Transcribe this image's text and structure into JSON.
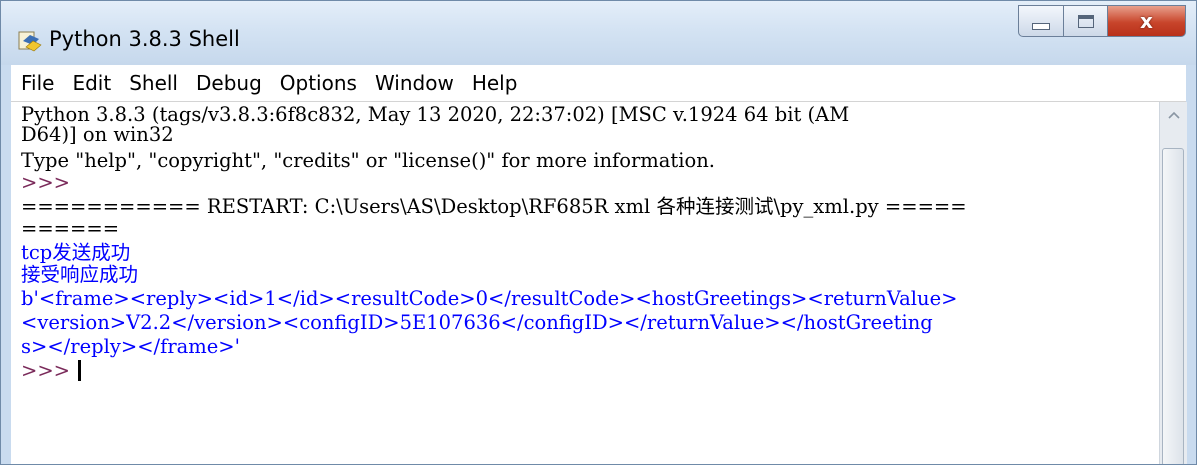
{
  "window": {
    "title": "Python 3.8.3 Shell",
    "close_glyph": "x"
  },
  "menu": [
    "File",
    "Edit",
    "Shell",
    "Debug",
    "Options",
    "Window",
    "Help"
  ],
  "shell": {
    "lines": [
      {
        "text": "Python 3.8.3 (tags/v3.8.3:6f8c832, May 13 2020, 22:37:02) [MSC v.1924 64 bit (AM",
        "color": "black"
      },
      {
        "text": "D64)] on win32",
        "color": "black"
      },
      {
        "text": "Type \"help\", \"copyright\", \"credits\" or \"license()\" for more information.",
        "color": "black"
      },
      {
        "text": ">>>",
        "color": "prompt"
      },
      {
        "text": "=========== RESTART: C:\\Users\\AS\\Desktop\\RF685R xml 各种连接测试\\py_xml.py =====",
        "color": "black"
      },
      {
        "text": "======",
        "color": "black"
      },
      {
        "text": "tcp发送成功",
        "color": "blue"
      },
      {
        "text": "接受响应成功",
        "color": "blue"
      },
      {
        "text": "b'<frame><reply><id>1</id><resultCode>0</resultCode><hostGreetings><returnValue>",
        "color": "blue"
      },
      {
        "text": "<version>V2.2</version><configID>5E107636</configID></returnValue></hostGreeting",
        "color": "blue"
      },
      {
        "text": "s></reply></frame>'",
        "color": "blue"
      }
    ],
    "final_prompt": ">>> "
  },
  "colors": {
    "output_blue": "#0000ff",
    "prompt": "#7a2a5a",
    "titlebar": "#d4e3f3",
    "close_button": "#c8452b"
  },
  "icons": {
    "app": "python-idle-icon",
    "minimize": "minimize-icon",
    "maximize": "maximize-icon",
    "close": "close-icon",
    "scroll_up": "scroll-up-arrow-icon"
  }
}
